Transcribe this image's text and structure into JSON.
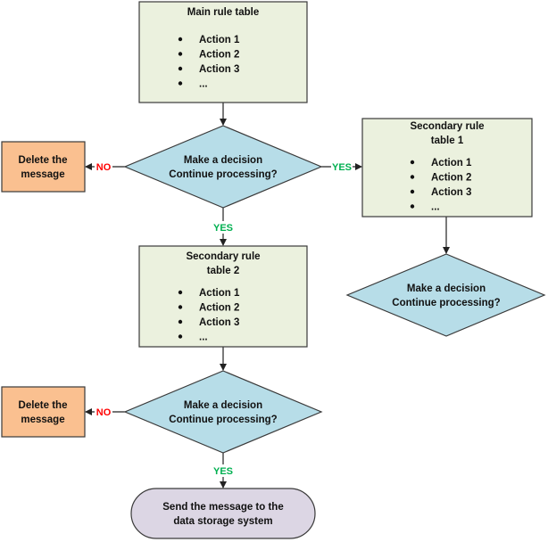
{
  "colors": {
    "rule_table": "#ebf1de",
    "decision": "#b7dde8",
    "delete": "#fac090",
    "terminal": "#dcd6e4",
    "no": "#ff0000",
    "yes": "#00b050"
  },
  "main_table": {
    "title": "Main rule table",
    "items": [
      "Action 1",
      "Action 2",
      "Action 3",
      "..."
    ]
  },
  "secondary_table_1": {
    "title_line1": "Secondary rule",
    "title_line2": "table 1",
    "items": [
      "Action 1",
      "Action 2",
      "Action 3",
      "..."
    ]
  },
  "secondary_table_2": {
    "title_line1": "Secondary rule",
    "title_line2": "table 2",
    "items": [
      "Action 1",
      "Action 2",
      "Action 3",
      "..."
    ]
  },
  "decision": {
    "line1": "Make a decision",
    "line2": "Continue processing?"
  },
  "delete": {
    "line1": "Delete the",
    "line2": "message"
  },
  "labels": {
    "no": "NO",
    "yes": "YES"
  },
  "terminal": {
    "line1": "Send the message to the",
    "line2": "data storage system"
  }
}
